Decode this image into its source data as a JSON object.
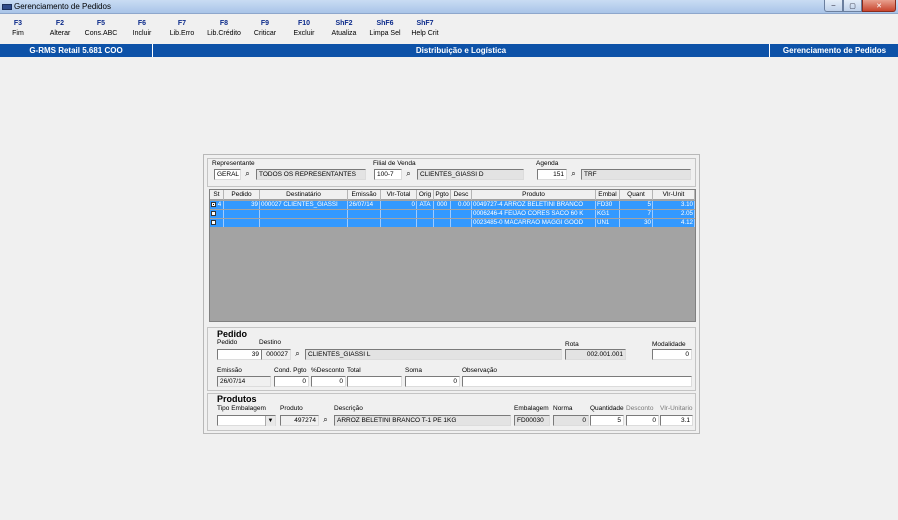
{
  "window": {
    "title": "Gerenciamento de Pedidos",
    "min": "–",
    "max": "▢",
    "close": "✕"
  },
  "toolbar": [
    {
      "key": "F3",
      "label": "Fim"
    },
    {
      "key": "F2",
      "label": "Alterar"
    },
    {
      "key": "F5",
      "label": "Cons.ABC"
    },
    {
      "key": "F6",
      "label": "Incluir"
    },
    {
      "key": "F7",
      "label": "Lib.Erro"
    },
    {
      "key": "F8",
      "label": "Lib.Crédito"
    },
    {
      "key": "F9",
      "label": "Criticar"
    },
    {
      "key": "F10",
      "label": "Excluir"
    },
    {
      "key": "ShF2",
      "label": "Atualiza"
    },
    {
      "key": "ShF6",
      "label": "Limpa Sel"
    },
    {
      "key": "ShF7",
      "label": "Help Crit"
    }
  ],
  "band": {
    "left": "G-RMS Retail 5.681 COO",
    "center": "Distribuição e Logística",
    "right": "Gerenciamento de Pedidos"
  },
  "filters": {
    "representante_label": "Representante",
    "representante_code": "GERAL",
    "representante_name": "TODOS OS REPRESENTANTES",
    "filial_label": "Filial de Venda",
    "filial_code": "100-7",
    "filial_name": "CLIENTES_GIASSI D",
    "agenda_label": "Agenda",
    "agenda_code": "151",
    "agenda_name": "TRF"
  },
  "grid": {
    "headers": [
      "St",
      "Pedido",
      "Destinatário",
      "Emissão",
      "Vlr-Total",
      "Orig",
      "Pgto",
      "Desc",
      "Produto",
      "Embal",
      "Quant",
      "Vlr-Unit"
    ],
    "rows": [
      {
        "st": "4",
        "pedido": "39",
        "destinatario": "000027 CLIENTES_GIASSI",
        "emissao": "26/07/14",
        "vlr_total": "0",
        "orig": "ATA",
        "pgto": "000",
        "desc": "0.00",
        "produto": "0049727-4 ARROZ BELETINI BRANCO",
        "embal": "FD30",
        "quant": "5",
        "vlr_unit": "3.10"
      },
      {
        "st": "",
        "pedido": "",
        "destinatario": "",
        "emissao": "",
        "vlr_total": "",
        "orig": "",
        "pgto": "",
        "desc": "",
        "produto": "0006246-4 FEIJAO CORES SACO 60 K",
        "embal": "KG1",
        "quant": "7",
        "vlr_unit": "2.05"
      },
      {
        "st": "",
        "pedido": "",
        "destinatario": "",
        "emissao": "",
        "vlr_total": "",
        "orig": "",
        "pgto": "",
        "desc": "",
        "produto": "0023485-0 MACARRAO MAGGI GOOD",
        "embal": "UN1",
        "quant": "30",
        "vlr_unit": "4.12"
      }
    ]
  },
  "pedido": {
    "title": "Pedido",
    "pedido_label": "Pedido",
    "pedido_value": "39",
    "destino_label": "Destino",
    "destino_code": "000027",
    "destino_name": "CLIENTES_GIASSI L",
    "rota_label": "Rota",
    "rota_value": "002.001.001",
    "modalidade_label": "Modalidade",
    "modalidade_value": "0",
    "emissao_label": "Emissão",
    "emissao_value": "26/07/14",
    "cond_label": "Cond. Pgto",
    "cond_value": "0",
    "desconto_label": "%Desconto",
    "desconto_value": "0",
    "total_label": "Total",
    "total_value": "",
    "soma_label": "Soma",
    "soma_value": "0",
    "obs_label": "Observação",
    "obs_value": ""
  },
  "produtos": {
    "title": "Produtos",
    "tipo_label": "Tipo Embalagem",
    "tipo_value": "",
    "produto_label": "Produto",
    "produto_value": "497274",
    "descricao_label": "Descrição",
    "descricao_value": "ARROZ BELETINI BRANCO T-1      PE   1KG",
    "embalagem_label": "Embalagem",
    "embalagem_value": "FD00030",
    "norma_label": "Norma",
    "norma_value": "0",
    "quantidade_label": "Quantidade",
    "quantidade_value": "5",
    "desconto_label": "Desconto",
    "desconto_value": "0",
    "vlr_label": "Vlr-Unitario",
    "vlr_value": "3.1"
  },
  "icons": {
    "binoculars": "binoculars-icon",
    "app": "app-icon",
    "dropdown": "dropdown-arrow-icon"
  },
  "colors": {
    "band": "#0d52a8",
    "selection": "#3399ff",
    "grid_bg": "#a3a3a3",
    "toolbar_key": "#0b2a8a"
  }
}
